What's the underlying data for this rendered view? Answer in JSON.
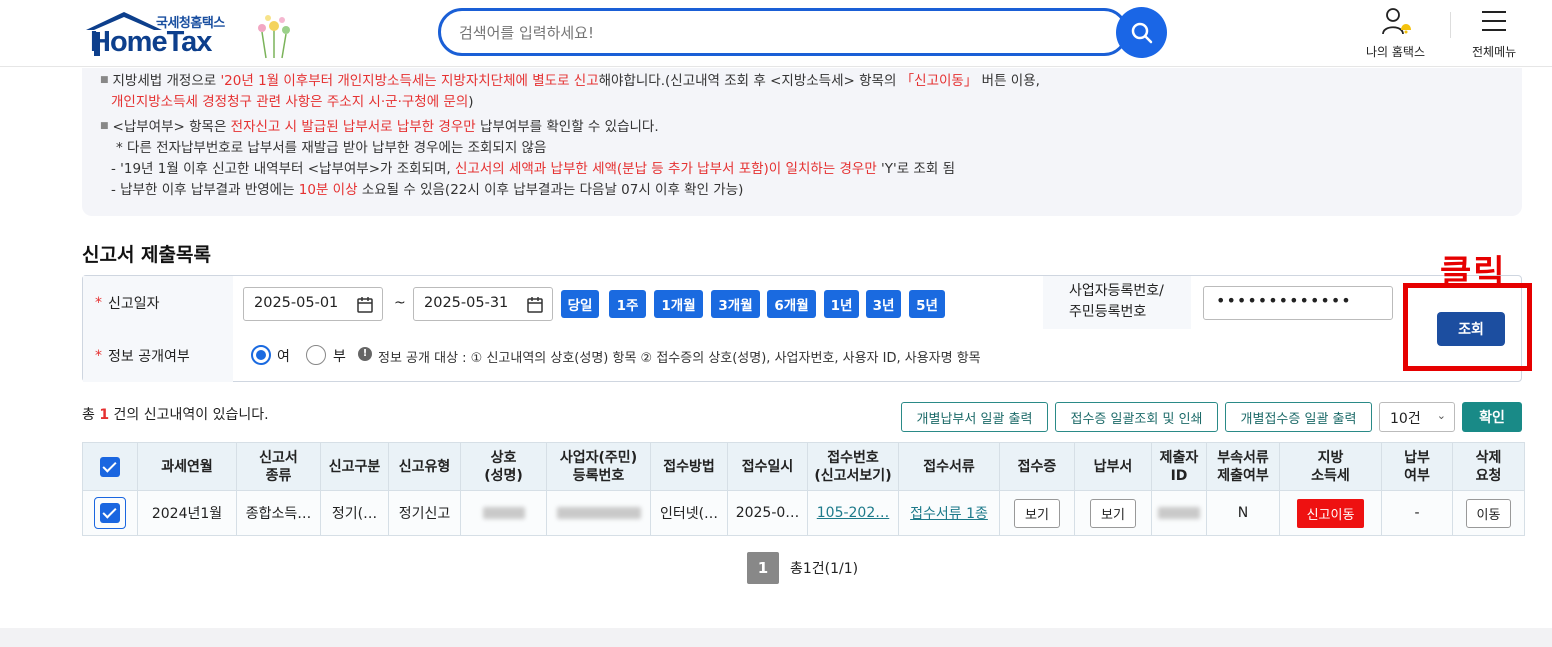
{
  "header": {
    "logo_sub": "국세청홈택스",
    "logo_main": "HomeTax",
    "search_placeholder": "검색어를 입력하세요!",
    "my_hometax": "나의 홈택스",
    "all_menu": "전체메뉴"
  },
  "notice": {
    "l1a": "지방세법 개정으로 ",
    "l1b": "'20년 1월 이후부터 개인지방소득세는 지방자치단체에 별도로 신고",
    "l1c": "해야합니다.(신고내역 조회 후 <지방소득세> 항목의 ",
    "l1d": "「신고이동」",
    "l1e": " 버튼 이용,",
    "l2a": "개인지방소득세 경정청구 관련 사항은 주소지 시·군·구청에 문의",
    "l2b": ")",
    "l3a": "<납부여부> 항목은 ",
    "l3b": "전자신고 시 발급된 납부서로 납부한 경우만",
    "l3c": " 납부여부를 확인할 수 있습니다.",
    "l4": "* 다른 전자납부번호로 납부서를 재발급 받아 납부한 경우에는 조회되지 않음",
    "l5a": "- '19년 1월 이후 신고한 내역부터 <납부여부>가 조회되며, ",
    "l5b": "신고서의 세액과 납부한 세액(분납 등 추가 납부서 포함)이 일치하는 경우만",
    "l5c": " 'Y'로 조회 됨",
    "l6a": "- 납부한 이후 납부결과 반영에는 ",
    "l6b": "10분 이상",
    "l6c": " 소요될 수 있음(22시 이후 납부결과는 다음날 07시 이후 확인 가능)"
  },
  "section_title": "신고서 제출목록",
  "filter": {
    "date_label": "신고일자",
    "date_from": "2025-05-01",
    "date_to": "2025-05-31",
    "tilde": "~",
    "periods": [
      "당일",
      "1주",
      "1개월",
      "3개월",
      "6개월",
      "1년",
      "3년",
      "5년"
    ],
    "biz_label_1": "사업자등록번호/",
    "biz_label_2": "주민등록번호",
    "biz_value": "•••••••••••••",
    "disclose_label": "정보 공개여부",
    "yes": "여",
    "no": "부",
    "info_icon": "!",
    "info_text": "정보 공개 대상 : ① 신고내역의 상호(성명) 항목 ② 접수증의 상호(성명), 사업자번호, 사용자 ID, 사용자명 항목",
    "query_button": "조회",
    "annotation": "클릭",
    "required_mark": "*"
  },
  "actions": {
    "count_pre": "총 ",
    "count_num": "1",
    "count_post": " 건의 신고내역이 있습니다.",
    "btn1": "개별납부서 일괄 출력",
    "btn2": "접수증 일괄조회 및 인쇄",
    "btn3": "개별접수증 일괄 출력",
    "page_size": "10건",
    "confirm": "확인"
  },
  "table": {
    "headers": [
      [
        "과세연월"
      ],
      [
        "신고서",
        "종류"
      ],
      [
        "신고구분"
      ],
      [
        "신고유형"
      ],
      [
        "상호",
        "(성명)"
      ],
      [
        "사업자(주민)",
        "등록번호"
      ],
      [
        "접수방법"
      ],
      [
        "접수일시"
      ],
      [
        "접수번호",
        "(신고서보기)"
      ],
      [
        "접수서류"
      ],
      [
        "접수증"
      ],
      [
        "납부서"
      ],
      [
        "제출자",
        "ID"
      ],
      [
        "부속서류",
        "제출여부"
      ],
      [
        "지방",
        "소득세"
      ],
      [
        "납부",
        "여부"
      ],
      [
        "삭제",
        "요청"
      ]
    ],
    "row": {
      "period": "2024년1월",
      "kind": "종합소득…",
      "div": "정기(…",
      "type": "정기신고",
      "method": "인터넷(…",
      "date": "2025-0…",
      "receipt_no": "105-202…",
      "docs": "접수서류 1종",
      "receipt": "보기",
      "bill": "보기",
      "attach": "N",
      "local_tax": "신고이동",
      "paid": "-",
      "delete": "이동"
    }
  },
  "pagination": {
    "page": "1",
    "summary": "총1건(1/1)"
  }
}
